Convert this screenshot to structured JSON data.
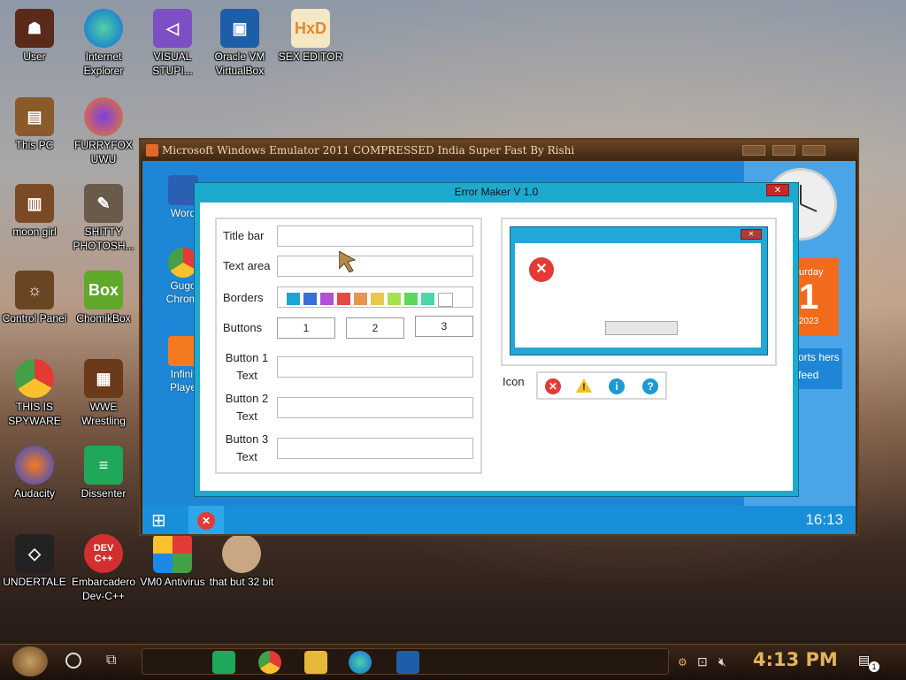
{
  "desktop": {
    "icons": [
      {
        "label": "User"
      },
      {
        "label": "Internet Explorer"
      },
      {
        "label": "VISUAL STUPI..."
      },
      {
        "label": "Oracle VM VirtualBox"
      },
      {
        "label": "SEX EDITOR"
      },
      {
        "label": "This PC"
      },
      {
        "label": "FURRYFOX UWU"
      },
      {
        "label": "moon girl"
      },
      {
        "label": "SHITTY PHOTOSH..."
      },
      {
        "label": "Control Panel"
      },
      {
        "label": "ChomikBox"
      },
      {
        "label": "THIS IS SPYWARE"
      },
      {
        "label": "WWE Wrestling"
      },
      {
        "label": "Audacity"
      },
      {
        "label": "Dissenter"
      },
      {
        "label": "UNDERTALE"
      },
      {
        "label": "Embarcadero Dev-C++"
      },
      {
        "label": "VM0 Antivirus"
      },
      {
        "label": "that but 32 bit"
      }
    ]
  },
  "emulator": {
    "title": "Microsoft Windows Emulator 2011 COMPRESSED India Super Fast By Rishi",
    "inner_icons": [
      {
        "label": "Word"
      },
      {
        "label": "Gugo Chromi"
      },
      {
        "label": "Infinit Playe"
      }
    ],
    "taskbar_time": "16:13",
    "calendar": {
      "header": "urday",
      "day": "1",
      "year": "2023"
    },
    "news": {
      "line1": "orts hers",
      "line2": "feed"
    }
  },
  "error_maker": {
    "title": "Error Maker V 1.0",
    "close": "✕",
    "labels": {
      "title_bar": "Title bar",
      "text_area": "Text area",
      "borders": "Borders",
      "buttons": "Buttons",
      "button1_a": "Button 1",
      "button1_b": "Text",
      "button2_a": "Button 2",
      "button2_b": "Text",
      "button3_a": "Button 3",
      "button3_b": "Text",
      "icon": "Icon"
    },
    "button_counts": [
      "1",
      "2",
      "3"
    ],
    "border_colors": [
      "#1aa6d6",
      "#3a6fd8",
      "#b04fd8",
      "#e24a4a",
      "#e8944a",
      "#e8c94a",
      "#a8e04a",
      "#5ad85a",
      "#4ad8a8",
      "#ffffff"
    ],
    "icon_glyphs": {
      "error": "✕",
      "warning": "!",
      "info": "i",
      "question": "?"
    },
    "colors": {
      "error": "#e53935",
      "warning": "#f4c21f",
      "info": "#1e9bd6",
      "question": "#1e9bd6"
    }
  },
  "taskbar": {
    "time": "4:13 PM",
    "notifications": "1"
  }
}
